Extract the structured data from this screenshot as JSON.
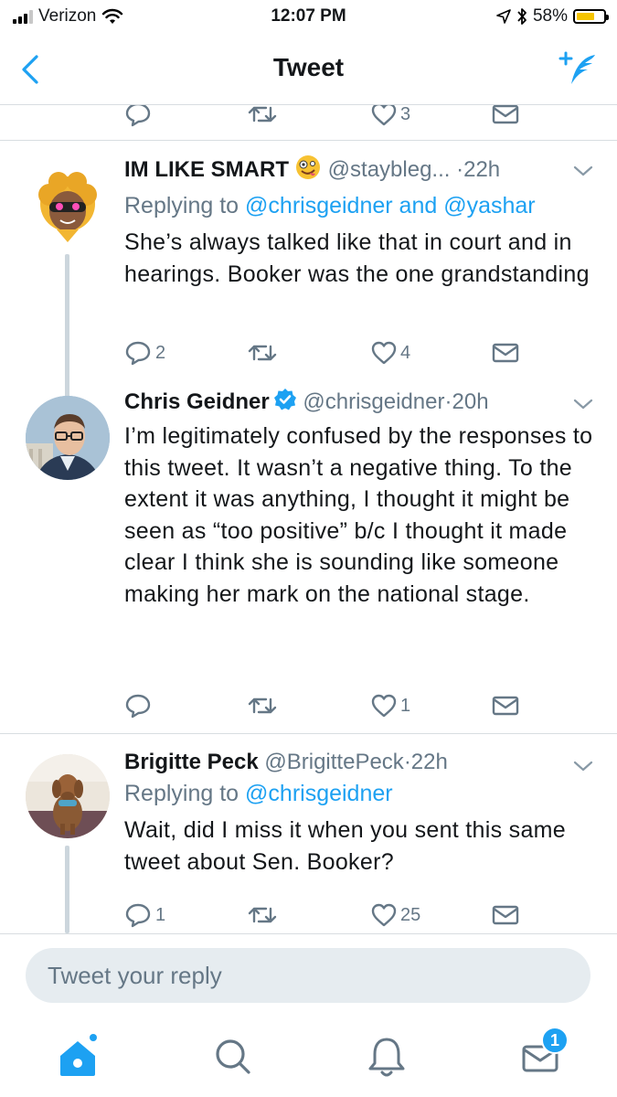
{
  "status_bar": {
    "carrier": "Verizon",
    "time": "12:07 PM",
    "battery": "58%",
    "battery_level": 0.58
  },
  "nav": {
    "title": "Tweet"
  },
  "top_actions": {
    "like_count": "3"
  },
  "tweets": [
    {
      "name": "IM LIKE SMART",
      "handle": "@staybleg...",
      "time": "·22h",
      "replying_label": "Replying to",
      "reply_mention_1": "@chrisgeidner",
      "reply_and": "and",
      "reply_mention_2": "@yashar",
      "text": "She’s always talked like that in court and in hearings. Booker was the one grandstanding",
      "reply_count": "2",
      "retweet_count": "",
      "like_count": "4",
      "icons": {
        "emoji": "zany-face-icon"
      }
    },
    {
      "name": "Chris Geidner",
      "handle": "@chrisgeidner",
      "time": "·20h",
      "verified": true,
      "text": "I’m legitimately confused by the responses to this tweet. It wasn’t a negative thing. To the extent it was anything, I thought it might be seen as “too positive” b/c I thought it made clear I think she is sounding like someone making her mark on the national stage.",
      "reply_count": "",
      "retweet_count": "",
      "like_count": "1"
    },
    {
      "name": "Brigitte Peck",
      "handle": "@BrigittePeck",
      "time": "·22h",
      "replying_label": "Replying to",
      "reply_mention_1": "@chrisgeidner",
      "text": "Wait, did I miss it when you sent this same tweet about Sen. Booker?",
      "reply_count": "1",
      "retweet_count": "",
      "like_count": "25"
    }
  ],
  "reply_box": {
    "placeholder": "Tweet your reply"
  },
  "tab_bar": {
    "messages_badge": "1"
  },
  "colors": {
    "accent": "#1da1f2",
    "muted": "#657786",
    "divider": "#d8dde1",
    "thread_line": "#ccd6dd"
  }
}
